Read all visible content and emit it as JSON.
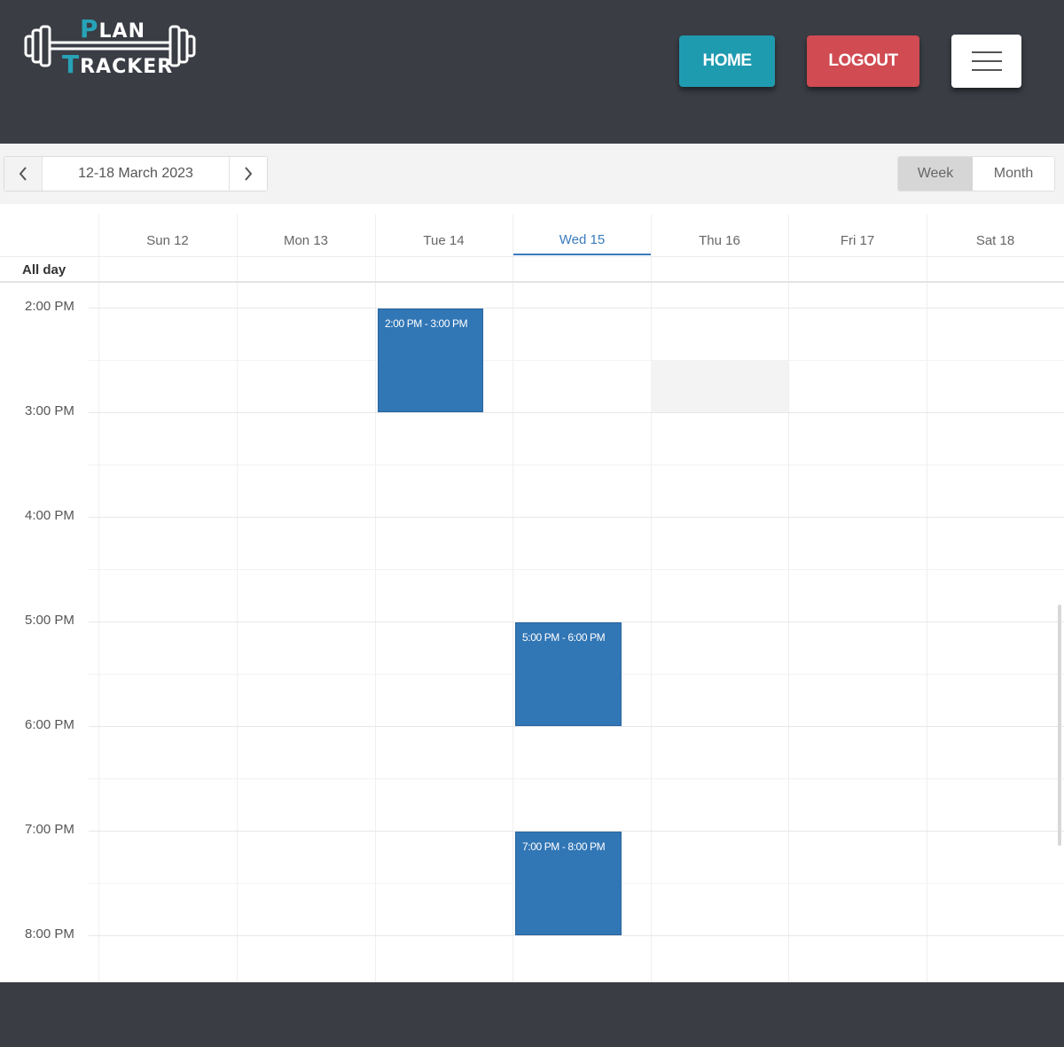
{
  "brand": {
    "plan_cap": "P",
    "plan_rest": "LAN",
    "tracker_cap": "T",
    "tracker_rest": "RACKER"
  },
  "header": {
    "home_label": "HOME",
    "logout_label": "LOGOUT",
    "menu_icon": "hamburger-icon"
  },
  "calendar": {
    "prev_icon": "chevron-left-icon",
    "next_icon": "chevron-right-icon",
    "date_range": "12-18 March 2023",
    "views": {
      "week": "Week",
      "month": "Month",
      "selected": "Week"
    },
    "days": [
      "Sun 12",
      "Mon 13",
      "Tue 14",
      "Wed 15",
      "Thu 16",
      "Fri 17",
      "Sat 18"
    ],
    "active_day": "Wed 15",
    "all_day_label": "All day",
    "times": [
      "2:00 PM",
      "3:00 PM",
      "4:00 PM",
      "5:00 PM",
      "6:00 PM",
      "7:00 PM",
      "8:00 PM"
    ],
    "events": [
      {
        "day": "Tue 14",
        "label": "2:00 PM - 3:00 PM"
      },
      {
        "day": "Wed 15",
        "label": "5:00 PM - 6:00 PM"
      },
      {
        "day": "Wed 15",
        "label": "7:00 PM - 8:00 PM"
      }
    ]
  },
  "colors": {
    "header_bg": "#3a3d44",
    "home_button": "#1f9bb0",
    "logout_button": "#d14b52",
    "event": "#3176b5",
    "active_day": "#3a7bbd",
    "logo_accent": "#27a3b8"
  }
}
